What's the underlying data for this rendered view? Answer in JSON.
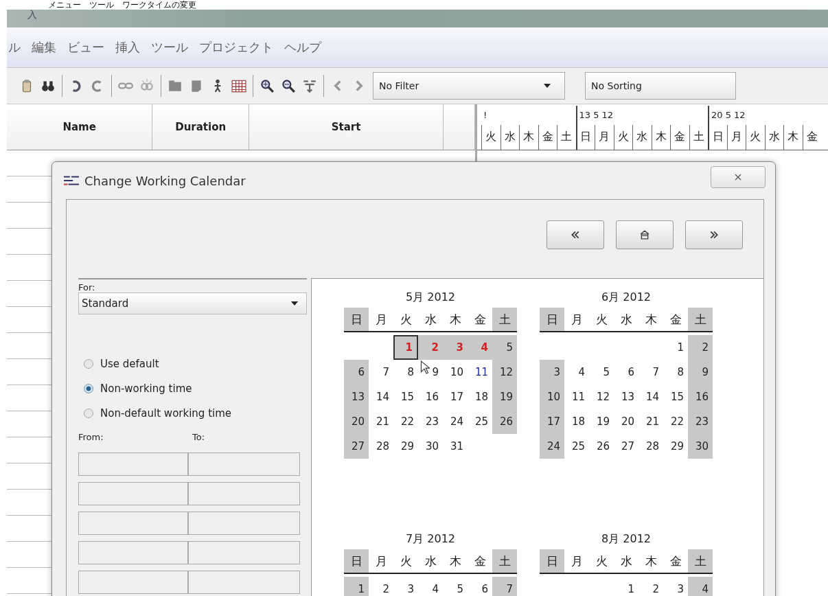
{
  "caption": "メニュー　ツール　ワークタイムの変更",
  "window": {
    "title": "入"
  },
  "menu": [
    "ル",
    "編集",
    "ビュー",
    "挿入",
    "ツール",
    "プロジェクト",
    "ヘルプ"
  ],
  "filter": {
    "value": "No Filter"
  },
  "sorting": {
    "value": "No Sorting"
  },
  "table": {
    "columns": [
      "Name",
      "Duration",
      "Start"
    ]
  },
  "gantt": {
    "weeks": [
      {
        "label": "!",
        "days": [
          "火",
          "水",
          "木",
          "金",
          "土"
        ]
      },
      {
        "label": "13 5 12",
        "days": [
          "日",
          "月",
          "火",
          "水",
          "木",
          "金",
          "土"
        ]
      },
      {
        "label": "20 5 12",
        "days": [
          "日",
          "月",
          "火",
          "水",
          "木",
          "金"
        ]
      }
    ]
  },
  "dialog": {
    "title": "Change Working Calendar",
    "for_label": "For:",
    "calendar": {
      "value": "Standard"
    },
    "options": [
      {
        "label": "Use default",
        "selected": false
      },
      {
        "label": "Non-working time",
        "selected": true
      },
      {
        "label": "Non-default working time",
        "selected": false
      }
    ],
    "from_label": "From:",
    "to_label": "To:",
    "time_rows": [
      {
        "disabled": true
      },
      {
        "disabled": true
      },
      {
        "disabled": true
      },
      {
        "disabled": true
      },
      {
        "disabled": true
      }
    ],
    "months": [
      {
        "title": "5月 2012",
        "weekdays": [
          "日",
          "月",
          "火",
          "水",
          "木",
          "金",
          "土"
        ],
        "weeks": [
          [
            {
              "d": "1",
              "kind": "exception",
              "selected": true
            },
            {
              "d": "2",
              "kind": "exception",
              "selected": false
            },
            {
              "d": "3",
              "kind": "exception",
              "selected": false
            },
            {
              "d": "4",
              "kind": "exception",
              "selected": false
            },
            {
              "d": "5",
              "kind": "normal",
              "selected": false
            }
          ],
          [
            {
              "d": "6",
              "kind": "normal",
              "selected": false
            },
            {
              "d": "7",
              "kind": "normal",
              "selected": false
            },
            {
              "d": "8",
              "kind": "normal",
              "selected": false
            },
            {
              "d": "9",
              "kind": "normal",
              "selected": false
            },
            {
              "d": "10",
              "kind": "normal",
              "selected": false
            },
            {
              "d": "11",
              "kind": "today",
              "selected": false
            },
            {
              "d": "12",
              "kind": "normal",
              "selected": false
            }
          ],
          [
            {
              "d": "13",
              "kind": "normal",
              "selected": false
            },
            {
              "d": "14",
              "kind": "normal",
              "selected": false
            },
            {
              "d": "15",
              "kind": "normal",
              "selected": false
            },
            {
              "d": "16",
              "kind": "normal",
              "selected": false
            },
            {
              "d": "17",
              "kind": "normal",
              "selected": false
            },
            {
              "d": "18",
              "kind": "normal",
              "selected": false
            },
            {
              "d": "19",
              "kind": "normal",
              "selected": false
            }
          ],
          [
            {
              "d": "20",
              "kind": "normal",
              "selected": false
            },
            {
              "d": "21",
              "kind": "normal",
              "selected": false
            },
            {
              "d": "22",
              "kind": "normal",
              "selected": false
            },
            {
              "d": "23",
              "kind": "normal",
              "selected": false
            },
            {
              "d": "24",
              "kind": "normal",
              "selected": false
            },
            {
              "d": "25",
              "kind": "normal",
              "selected": false
            },
            {
              "d": "26",
              "kind": "normal",
              "selected": false
            }
          ],
          [
            {
              "d": "27",
              "kind": "normal",
              "selected": false
            },
            {
              "d": "28",
              "kind": "normal",
              "selected": false
            },
            {
              "d": "29",
              "kind": "normal",
              "selected": false
            },
            {
              "d": "30",
              "kind": "normal",
              "selected": false
            },
            {
              "d": "31",
              "kind": "normal",
              "selected": false
            }
          ]
        ]
      },
      {
        "title": "6月 2012",
        "weekdays": [
          "日",
          "月",
          "火",
          "水",
          "木",
          "金",
          "土"
        ],
        "weeks": [
          [
            {
              "d": "1",
              "kind": "normal",
              "selected": false
            },
            {
              "d": "2",
              "kind": "normal",
              "selected": false
            }
          ],
          [
            {
              "d": "3",
              "kind": "normal",
              "selected": false
            },
            {
              "d": "4",
              "kind": "normal",
              "selected": false
            },
            {
              "d": "5",
              "kind": "normal",
              "selected": false
            },
            {
              "d": "6",
              "kind": "normal",
              "selected": false
            },
            {
              "d": "7",
              "kind": "normal",
              "selected": false
            },
            {
              "d": "8",
              "kind": "normal",
              "selected": false
            },
            {
              "d": "9",
              "kind": "normal",
              "selected": false
            }
          ],
          [
            {
              "d": "10",
              "kind": "normal",
              "selected": false
            },
            {
              "d": "11",
              "kind": "normal",
              "selected": false
            },
            {
              "d": "12",
              "kind": "normal",
              "selected": false
            },
            {
              "d": "13",
              "kind": "normal",
              "selected": false
            },
            {
              "d": "14",
              "kind": "normal",
              "selected": false
            },
            {
              "d": "15",
              "kind": "normal",
              "selected": false
            },
            {
              "d": "16",
              "kind": "normal",
              "selected": false
            }
          ],
          [
            {
              "d": "17",
              "kind": "normal",
              "selected": false
            },
            {
              "d": "18",
              "kind": "normal",
              "selected": false
            },
            {
              "d": "19",
              "kind": "normal",
              "selected": false
            },
            {
              "d": "20",
              "kind": "normal",
              "selected": false
            },
            {
              "d": "21",
              "kind": "normal",
              "selected": false
            },
            {
              "d": "22",
              "kind": "normal",
              "selected": false
            },
            {
              "d": "23",
              "kind": "normal",
              "selected": false
            }
          ],
          [
            {
              "d": "24",
              "kind": "normal",
              "selected": false
            },
            {
              "d": "25",
              "kind": "normal",
              "selected": false
            },
            {
              "d": "26",
              "kind": "normal",
              "selected": false
            },
            {
              "d": "27",
              "kind": "normal",
              "selected": false
            },
            {
              "d": "28",
              "kind": "normal",
              "selected": false
            },
            {
              "d": "29",
              "kind": "normal",
              "selected": false
            },
            {
              "d": "30",
              "kind": "normal",
              "selected": false
            }
          ]
        ]
      },
      {
        "title": "7月 2012",
        "weekdays": [
          "日",
          "月",
          "火",
          "水",
          "木",
          "金",
          "土"
        ],
        "weeks": [
          [
            {
              "d": "1",
              "kind": "normal",
              "selected": false
            },
            {
              "d": "2",
              "kind": "normal",
              "selected": false
            },
            {
              "d": "3",
              "kind": "normal",
              "selected": false
            },
            {
              "d": "4",
              "kind": "normal",
              "selected": false
            },
            {
              "d": "5",
              "kind": "normal",
              "selected": false
            },
            {
              "d": "6",
              "kind": "normal",
              "selected": false
            },
            {
              "d": "7",
              "kind": "normal",
              "selected": false
            }
          ]
        ]
      },
      {
        "title": "8月 2012",
        "weekdays": [
          "日",
          "月",
          "火",
          "水",
          "木",
          "金",
          "土"
        ],
        "weeks": [
          [
            {
              "d": "1",
              "kind": "normal",
              "selected": false
            },
            {
              "d": "2",
              "kind": "normal",
              "selected": false
            },
            {
              "d": "3",
              "kind": "normal",
              "selected": false
            },
            {
              "d": "4",
              "kind": "normal",
              "selected": false
            }
          ]
        ]
      }
    ]
  }
}
